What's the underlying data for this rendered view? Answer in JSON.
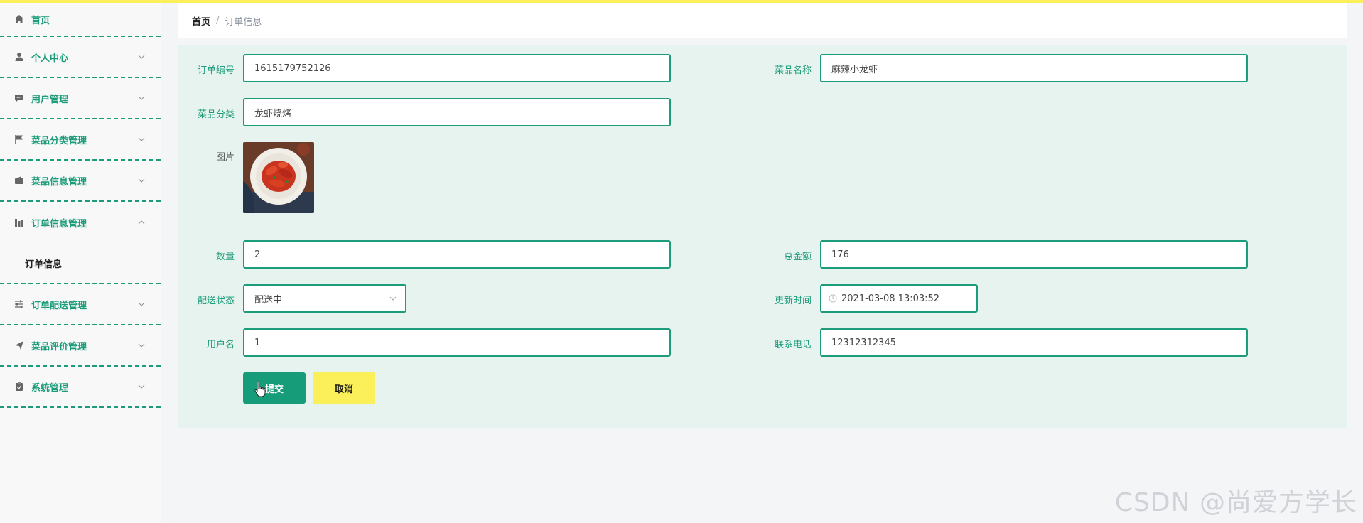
{
  "colors": {
    "accent": "#1c9c7a",
    "topbar": "#fbef5a",
    "panel": "#e6f3ef",
    "cancel": "#fbf05a"
  },
  "sidebar": {
    "home": {
      "label": "首页",
      "icon": "home-icon"
    },
    "items": [
      {
        "label": "个人中心",
        "icon": "user-icon"
      },
      {
        "label": "用户管理",
        "icon": "chat-icon"
      },
      {
        "label": "菜品分类管理",
        "icon": "flag-icon"
      },
      {
        "label": "菜品信息管理",
        "icon": "wallet-icon"
      }
    ],
    "expanded": {
      "label": "订单信息管理",
      "icon": "chart-icon",
      "child": "订单信息"
    },
    "items_after": [
      {
        "label": "订单配送管理",
        "icon": "sliders-icon"
      },
      {
        "label": "菜品评价管理",
        "icon": "send-icon"
      },
      {
        "label": "系统管理",
        "icon": "clipboard-icon"
      }
    ]
  },
  "breadcrumb": {
    "home": "首页",
    "separator": "/",
    "current": "订单信息"
  },
  "form": {
    "order_no": {
      "label": "订单编号",
      "value": "1615179752126"
    },
    "dish_name": {
      "label": "菜品名称",
      "value": "麻辣小龙虾"
    },
    "category": {
      "label": "菜品分类",
      "value": "龙虾烧烤"
    },
    "image": {
      "label": "图片"
    },
    "quantity": {
      "label": "数量",
      "value": "2"
    },
    "total": {
      "label": "总金额",
      "value": "176"
    },
    "delivery_status": {
      "label": "配送状态",
      "value": "配送中"
    },
    "update_time": {
      "label": "更新时间",
      "value": "2021-03-08 13:03:52"
    },
    "username": {
      "label": "用户名",
      "value": "1"
    },
    "phone": {
      "label": "联系电话",
      "value": "12312312345"
    }
  },
  "buttons": {
    "submit": "提交",
    "cancel": "取消"
  },
  "watermark": "CSDN @尚爱方学长"
}
